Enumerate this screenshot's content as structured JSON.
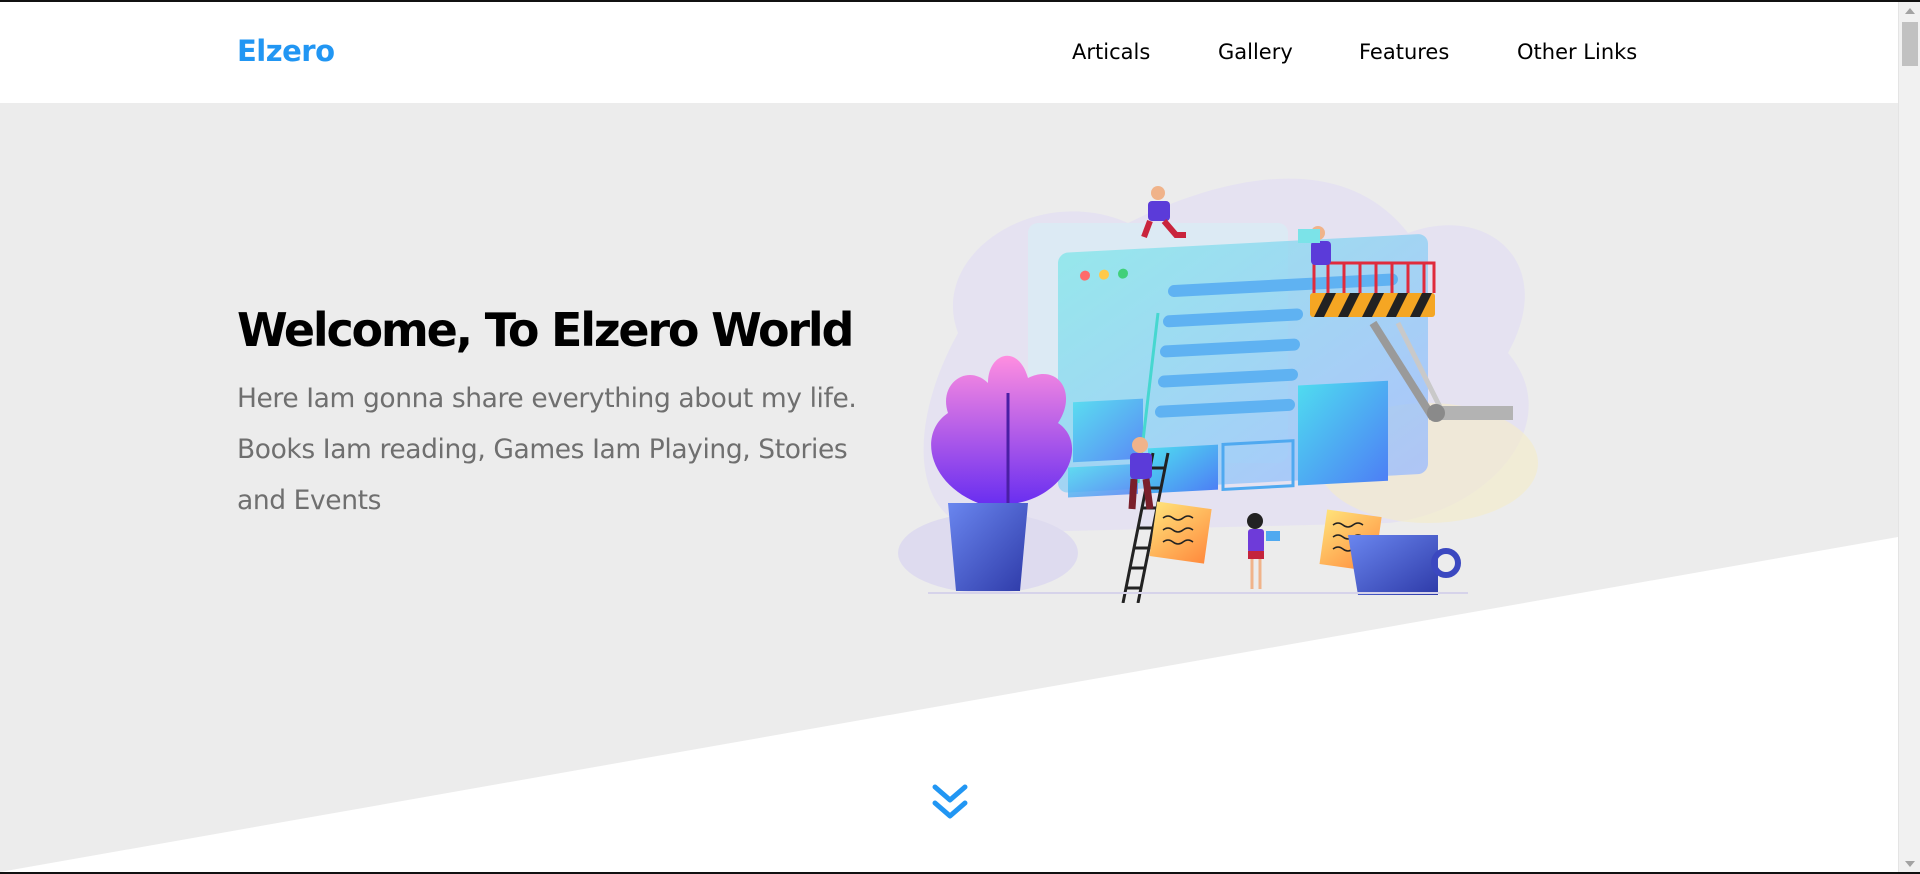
{
  "brand": {
    "name": "Elzero",
    "color": "#2196f3"
  },
  "nav": {
    "items": [
      {
        "label": "Articals"
      },
      {
        "label": "Gallery"
      },
      {
        "label": "Features"
      },
      {
        "label": "Other Links"
      }
    ]
  },
  "hero": {
    "title": "Welcome, To Elzero World",
    "text": "Here Iam gonna share everything about my life. Books Iam reading, Games Iam Playing, Stories and Events",
    "background": "#ececec"
  },
  "icons": {
    "scroll_down": "double-chevron-down-icon"
  }
}
